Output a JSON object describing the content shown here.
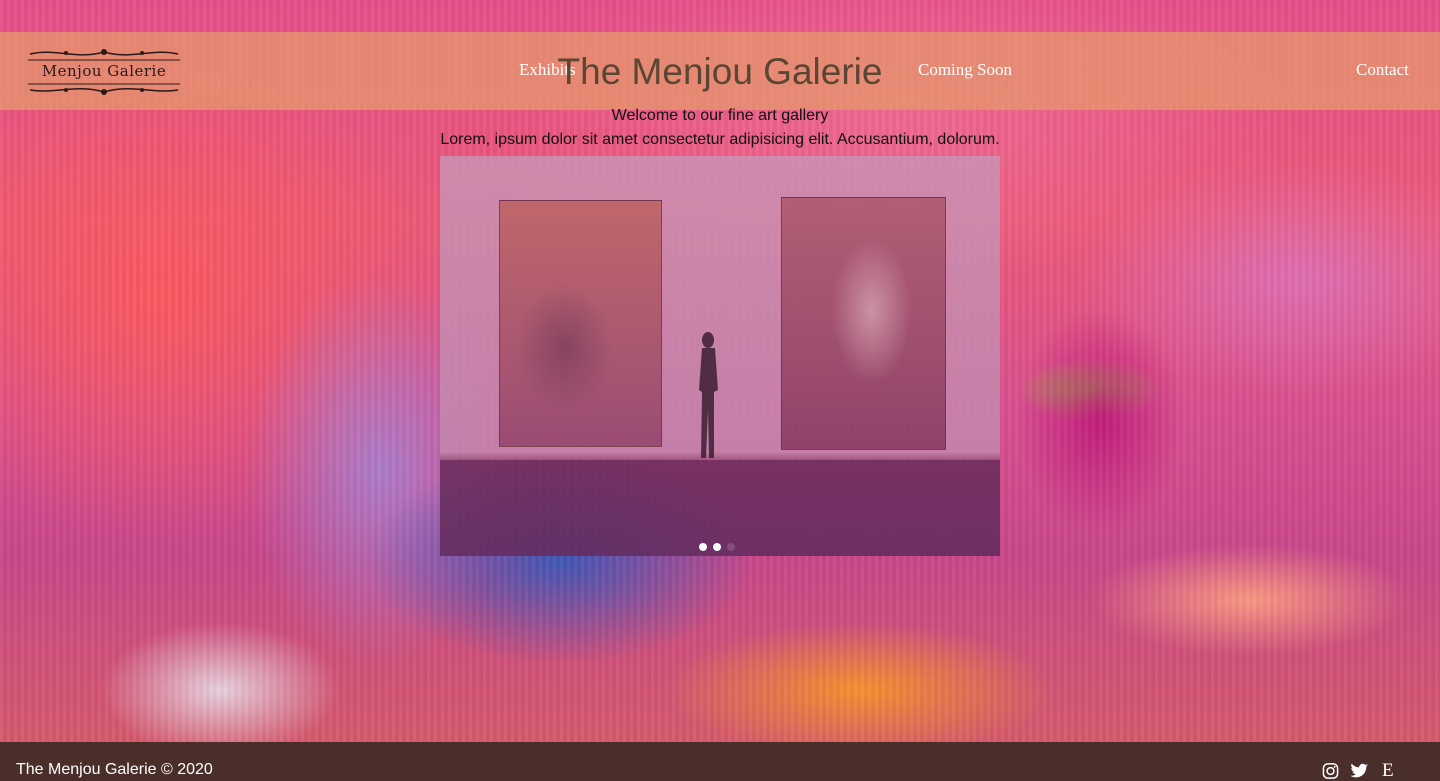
{
  "header": {
    "logo_text": "Menjou Galerie",
    "site_title": "The Menjou Galerie",
    "nav": [
      {
        "label": "Exhibits"
      },
      {
        "label": "Coming Soon"
      },
      {
        "label": "Contact"
      }
    ]
  },
  "intro": {
    "welcome": "Welcome to our fine art gallery",
    "lorem": "Lorem, ipsum dolor sit amet consectetur adipisicing elit. Accusantium, dolorum."
  },
  "carousel": {
    "slide_count": 3,
    "active_index": 0
  },
  "footer": {
    "copyright": "The Menjou Galerie © 2020",
    "social": [
      {
        "icon": "instagram-icon"
      },
      {
        "icon": "twitter-icon"
      },
      {
        "icon": "etsy-icon",
        "glyph": "E"
      }
    ]
  },
  "colors": {
    "navbar": "#e6966e",
    "footer": "#4a2e2a",
    "title": "#5a4632"
  }
}
